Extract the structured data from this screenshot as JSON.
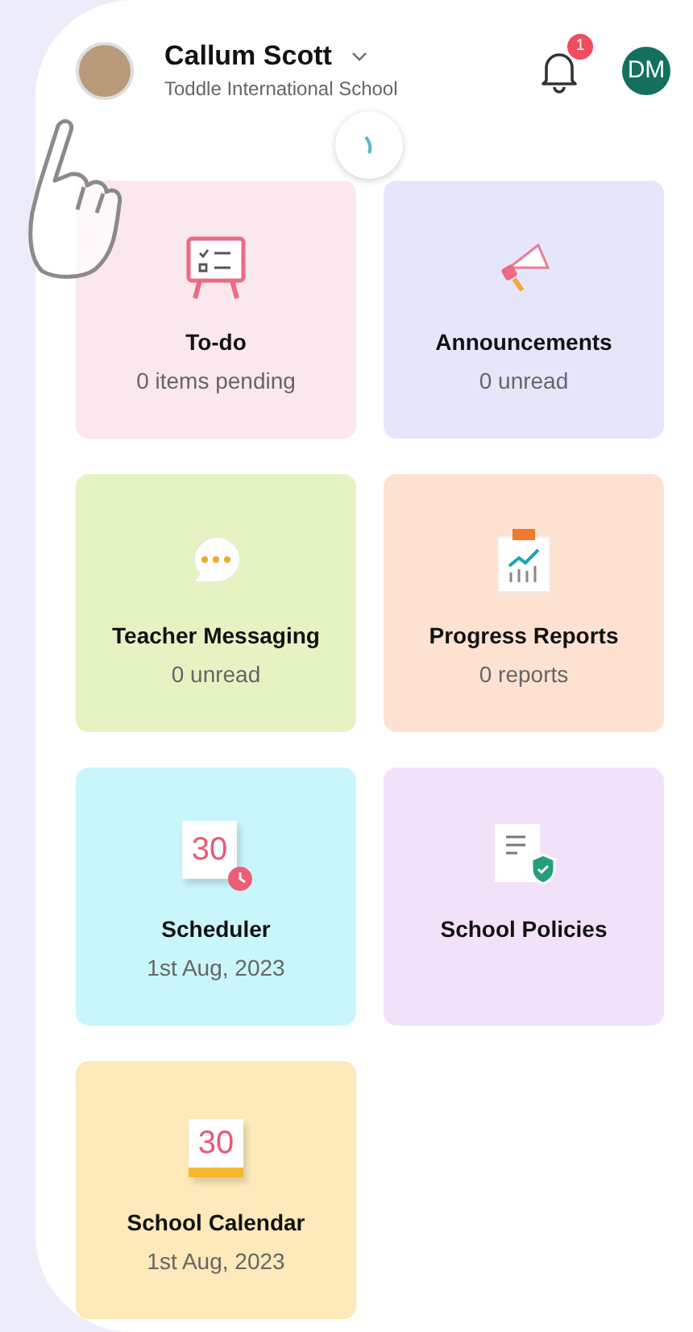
{
  "header": {
    "name": "Callum Scott",
    "school": "Toddle International School",
    "notification_count": "1",
    "account_initials": "DM"
  },
  "cards": [
    {
      "kind": "todo",
      "title": "To-do",
      "subtitle": "0 items pending",
      "color": "#fbe7ee"
    },
    {
      "kind": "announcement",
      "title": "Announcements",
      "subtitle": "0 unread",
      "color": "#e6e6fb"
    },
    {
      "kind": "message",
      "title": "Teacher Messaging",
      "subtitle": "0 unread",
      "color": "#e5f3c3"
    },
    {
      "kind": "report",
      "title": "Progress Reports",
      "subtitle": "0 reports",
      "color": "#fde2d2"
    },
    {
      "kind": "scheduler",
      "title": "Scheduler",
      "subtitle": "1st Aug, 2023",
      "color": "#c9f6fb",
      "icon_number": "30"
    },
    {
      "kind": "policy",
      "title": "School Policies",
      "color": "#f2e2f9"
    },
    {
      "kind": "calendar",
      "title": "School Calendar",
      "subtitle": "1st Aug, 2023",
      "color": "#fde9b9",
      "icon_number": "30"
    }
  ]
}
